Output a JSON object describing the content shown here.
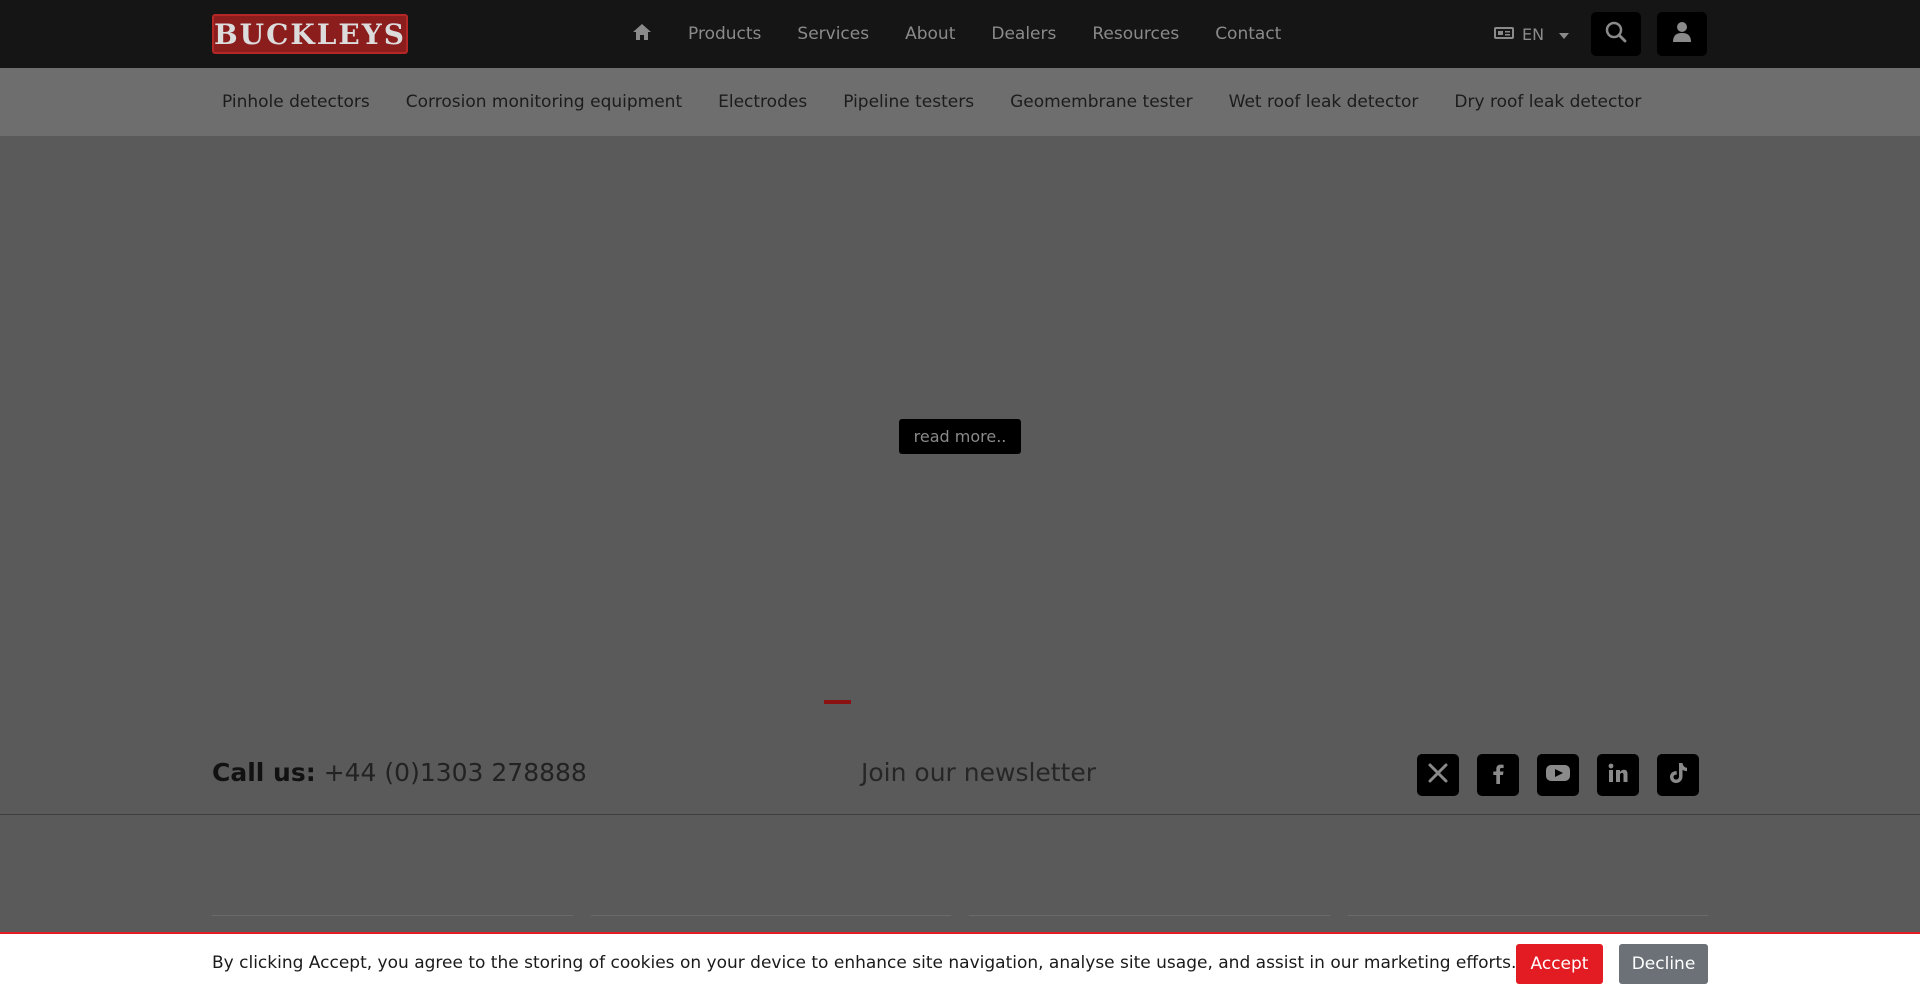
{
  "header": {
    "logo_text": "BUCKLEYS",
    "home_icon": "home-icon",
    "nav": [
      "Products",
      "Services",
      "About",
      "Dealers",
      "Resources",
      "Contact"
    ],
    "language": {
      "icon": "language-icon",
      "code": "EN"
    },
    "search_icon": "search-icon",
    "account_icon": "user-icon"
  },
  "subnav": [
    "Pinhole detectors",
    "Corrosion monitoring equipment",
    "Electrodes",
    "Pipeline testers",
    "Geomembrane tester",
    "Wet roof leak detector",
    "Dry roof leak detector"
  ],
  "hero": {
    "read_more": "read more.."
  },
  "contact": {
    "call_label": "Call us:",
    "phone": "+44 (0)1303 278888",
    "newsletter": "Join our newsletter",
    "social": [
      "x-icon",
      "facebook-icon",
      "youtube-icon",
      "linkedin-icon",
      "tiktok-icon"
    ]
  },
  "cookie": {
    "text": "By clicking Accept, you agree to the storing of cookies on your device to enhance site navigation, analyse site usage, and assist in our marketing efforts.",
    "accept": "Accept",
    "decline": "Decline"
  },
  "colors": {
    "brand_red": "#e31b23",
    "header_bg": "#151515",
    "overlay_bg": "#5a5a5a"
  }
}
